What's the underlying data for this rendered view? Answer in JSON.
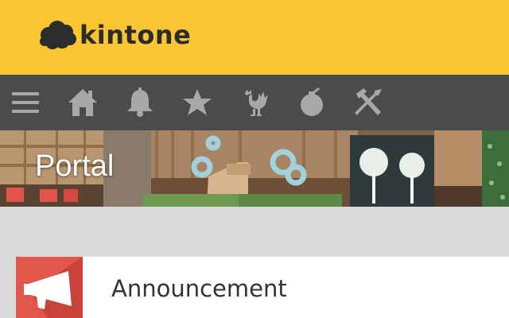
{
  "app": {
    "logo_text": "kintone",
    "logo_icon": "cloud-icon"
  },
  "nav": {
    "items": [
      {
        "id": "menu",
        "icon": "hamburger-menu-icon"
      },
      {
        "id": "home",
        "icon": "home-icon"
      },
      {
        "id": "notifications",
        "icon": "bell-icon"
      },
      {
        "id": "favorites",
        "icon": "star-icon"
      },
      {
        "id": "people",
        "icon": "rooster-icon"
      },
      {
        "id": "space",
        "icon": "bomb-icon"
      },
      {
        "id": "settings",
        "icon": "wrench-hammer-icon"
      }
    ]
  },
  "banner": {
    "title": "Portal"
  },
  "cards": [
    {
      "label": "Announcement",
      "icon": "megaphone-icon"
    }
  ],
  "colors": {
    "brand_yellow": "#f9c530",
    "nav_dark": "#4b4b4b",
    "nav_icon": "#a8a8a8",
    "content_bg": "#d8dadc",
    "announcement_red": "#e2564b"
  }
}
